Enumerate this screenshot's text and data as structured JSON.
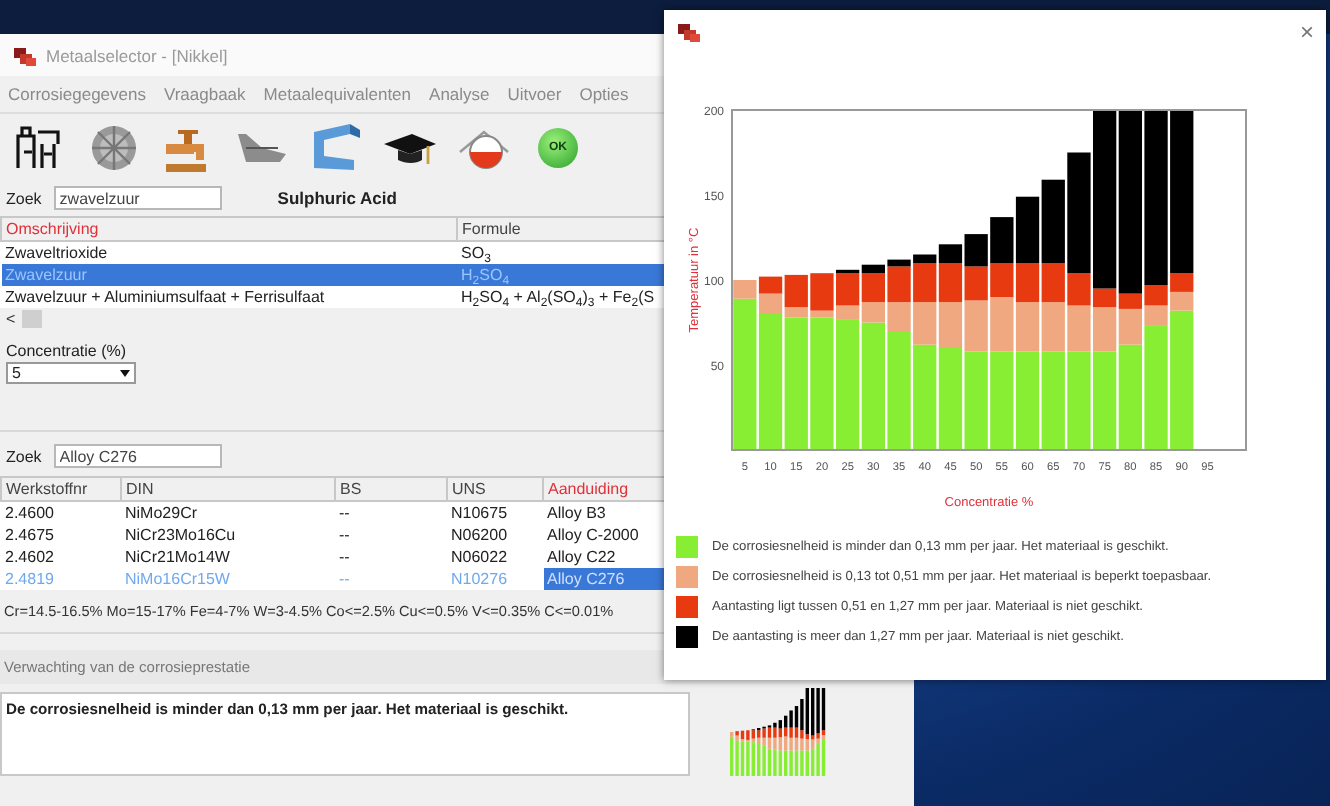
{
  "main_window": {
    "title": "Metaalselector - [Nikkel]",
    "menu": [
      "Corrosiegegevens",
      "Vraagbaak",
      "Metaalequivalenten",
      "Analyse",
      "Uitvoer",
      "Opties"
    ],
    "toolbar": {
      "ok_label": "OK"
    },
    "medium_search": {
      "label": "Zoek",
      "value": "zwavelzuur",
      "result": "Sulphuric Acid"
    },
    "media_table": {
      "columns": [
        {
          "label": "Omschrijving",
          "active": true
        },
        {
          "label": "Formule",
          "active": false
        }
      ],
      "rows": [
        {
          "cells": [
            "Zwaveltrioxide",
            "SO$_{3}$"
          ],
          "selected": false
        },
        {
          "cells": [
            "Zwavelzuur",
            "H$_{2}$SO$_{4}$"
          ],
          "selected": true
        },
        {
          "cells": [
            "Zwavelzuur + Aluminiumsulfaat + Ferrisulfaat",
            "H$_{2}$SO$_{4}$ + Al$_{2}$(SO$_{4}$)$_{3}$ + Fe$_{2}$(S"
          ],
          "selected": false
        }
      ]
    },
    "scroll_left": "<",
    "concentration": {
      "label": "Concentratie (%)",
      "value": "5"
    },
    "alloy_search": {
      "label": "Zoek",
      "value": "Alloy C276"
    },
    "alloy_table": {
      "columns": [
        {
          "label": "Werkstoffnr",
          "active": false
        },
        {
          "label": "DIN",
          "active": false
        },
        {
          "label": "BS",
          "active": false
        },
        {
          "label": "UNS",
          "active": false
        },
        {
          "label": "Aanduiding",
          "active": true
        }
      ],
      "rows": [
        {
          "cells": [
            "2.4600",
            "NiMo29Cr",
            "--",
            "N10675",
            "Alloy B3"
          ],
          "selected": false
        },
        {
          "cells": [
            "2.4675",
            "NiCr23Mo16Cu",
            "--",
            "N06200",
            "Alloy C-2000"
          ],
          "selected": false
        },
        {
          "cells": [
            "2.4602",
            "NiCr21Mo14W",
            "--",
            "N06022",
            "Alloy C22"
          ],
          "selected": false
        },
        {
          "cells": [
            "2.4819",
            "NiMo16Cr15W",
            "--",
            "N10276",
            "Alloy C276"
          ],
          "selected": true
        }
      ]
    },
    "composition": "Cr=14.5-16.5% Mo=15-17% Fe=4-7% W=3-4.5% Co<=2.5% Cu<=0.5% V<=0.35% C<=0.01%",
    "expectation": {
      "label": "Verwachting van de corrosieprestatie",
      "text": "De corrosiesnelheid is minder dan 0,13 mm per jaar. Het materiaal is geschikt."
    }
  },
  "chart_window": {
    "close": "×",
    "chart_data": {
      "type": "bar",
      "stacked": true,
      "xlabel": "Concentratie %",
      "ylabel": "Temperatuur in °C",
      "x": [
        5,
        10,
        15,
        20,
        25,
        30,
        35,
        40,
        45,
        50,
        55,
        60,
        65,
        70,
        75,
        80,
        85,
        90
      ],
      "xticks": [
        5,
        10,
        15,
        20,
        25,
        30,
        35,
        40,
        45,
        50,
        55,
        60,
        65,
        70,
        75,
        80,
        85,
        90,
        95
      ],
      "yticks": [
        50,
        100,
        150,
        200
      ],
      "xlim": [
        2.5,
        102.5
      ],
      "ylim": [
        0,
        200
      ],
      "series": [
        {
          "name": "De corrosiesnelheid is minder dan 0,13 mm per jaar. Het materiaal is geschikt.",
          "color": "#88ee33",
          "values": [
            89,
            80,
            78,
            78,
            77,
            75,
            70,
            62,
            60,
            58,
            58,
            58,
            58,
            58,
            58,
            62,
            73,
            82
          ]
        },
        {
          "name": "De corrosiesnelheid is 0,13 tot 0,51 mm per jaar. Het materiaal is beperkt toepasbaar.",
          "color": "#f0a880",
          "values": [
            11,
            12,
            6,
            4,
            8,
            12,
            17,
            25,
            27,
            30,
            32,
            29,
            29,
            27,
            26,
            21,
            12,
            11
          ]
        },
        {
          "name": "Aantasting ligt tussen 0,51 en 1,27 mm per jaar. Materiaal is niet geschikt.",
          "color": "#e83a10",
          "values": [
            null,
            10,
            19,
            22,
            19,
            17,
            21,
            23,
            23,
            20,
            20,
            23,
            23,
            19,
            11,
            9,
            12,
            11
          ]
        },
        {
          "name": "De aantasting is meer dan 1,27 mm per jaar. Materiaal is niet geschikt.",
          "color": "#000000",
          "values": [
            null,
            null,
            null,
            null,
            2,
            5,
            4,
            5,
            11,
            19,
            27,
            39,
            49,
            71,
            105,
            108,
            103,
            96
          ]
        }
      ]
    }
  }
}
